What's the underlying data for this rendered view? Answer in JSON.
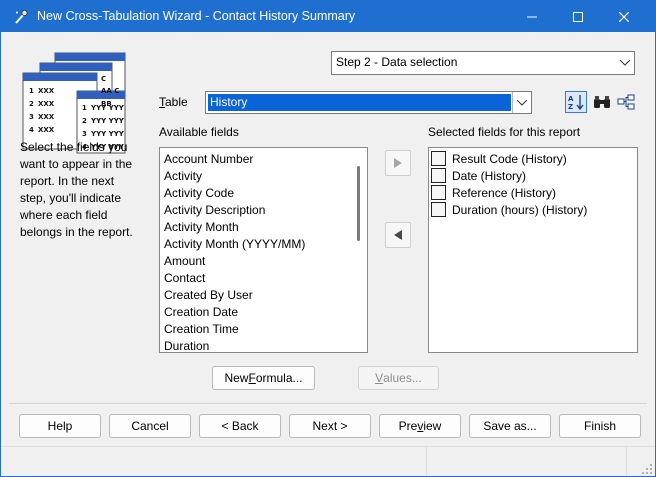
{
  "window": {
    "title": "New Cross-Tabulation Wizard - Contact History Summary"
  },
  "step_select": {
    "value": "Step 2 - Data selection"
  },
  "table": {
    "label_u": "T",
    "label_rest": "able",
    "value": "History"
  },
  "available": {
    "label": "Available fields",
    "items": [
      "Account Number",
      "Activity",
      "Activity Code",
      "Activity Description",
      "Activity Month",
      "Activity Month (YYYY/MM)",
      "Amount",
      "Contact",
      "Created By User",
      "Creation Date",
      "Creation Time",
      "Duration"
    ]
  },
  "selected": {
    "label": "Selected fields for this report",
    "items": [
      "Result Code (History)",
      "Date (History)",
      "Reference (History)",
      "Duration (hours) (History)"
    ]
  },
  "description": "Select the fields you want to appear in the report. In the next step, you'll indicate where each field belongs in the report.",
  "description_lines": [
    "Select the fields you",
    "want to appear in the",
    "report. In the next",
    "step, you'll indicate",
    "where each field",
    "belongs in the report."
  ],
  "formula_button": {
    "pre": "New ",
    "u": "F",
    "post": "ormula..."
  },
  "values_button": {
    "u": "V",
    "post": "alues..."
  },
  "footer": {
    "help": "Help",
    "cancel": "Cancel",
    "back": "< Back",
    "next": "Next >",
    "preview_pre": "Pre",
    "preview_u": "v",
    "preview_post": "iew",
    "saveas": "Save as...",
    "finish": "Finish"
  },
  "icons": {
    "sort": "sort-az-icon",
    "find": "binoculars-icon",
    "tree": "tree-view-icon",
    "add": "arrow-right-icon",
    "remove": "arrow-left-icon",
    "close": "close-icon",
    "maximize": "maximize-icon",
    "minimize": "minimize-icon"
  },
  "colors": {
    "titlebar": "#1f6fd1",
    "selection": "#0a64d8"
  }
}
